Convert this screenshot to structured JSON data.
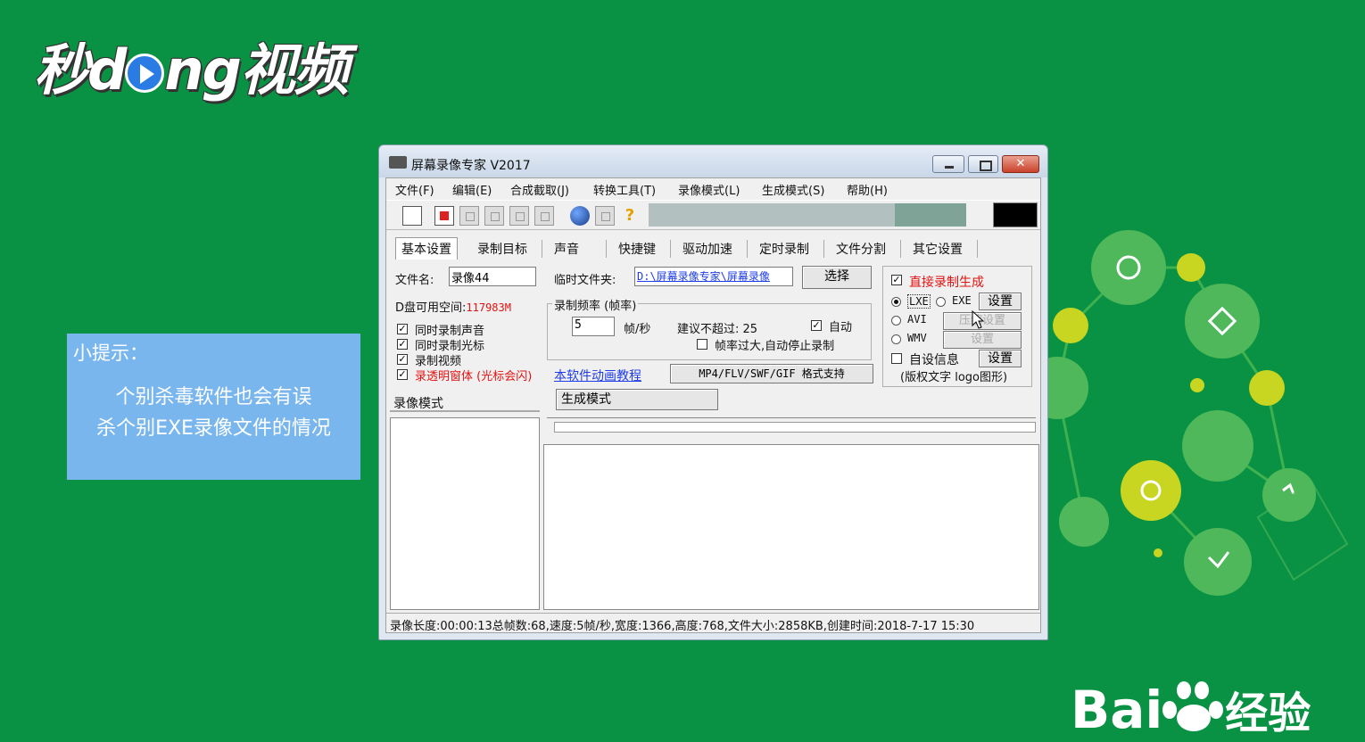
{
  "logo": {
    "part1": "秒d",
    "part2": "ng视频"
  },
  "tip": {
    "title": "小提示：",
    "line1": "个别杀毒软件也会有误",
    "line2": "杀个别EXE录像文件的情况"
  },
  "baidu": {
    "text1": "Bai",
    "text2": "经验"
  },
  "window": {
    "title": "屏幕录像专家 V2017",
    "close_glyph": "✕",
    "menu": [
      "文件(F)",
      "编辑(E)",
      "合成截取(J)",
      "转换工具(T)",
      "录像模式(L)",
      "生成模式(S)",
      "帮助(H)"
    ],
    "help_glyph": "?",
    "tabs": [
      "基本设置",
      "录制目标",
      "声音",
      "快捷键",
      "驱动加速",
      "定时录制",
      "文件分割",
      "其它设置"
    ],
    "filename_label": "文件名:",
    "filename_value": "录像44",
    "tempdir_label": "临时文件夹:",
    "tempdir_value": "D:\\屏幕录像专家\\屏幕录像",
    "choose_button": "选择",
    "disk_label": "D盘可用空间:",
    "disk_value": "117983M",
    "fps_group": "录制频率 (帧率)",
    "fps_value": "5",
    "fps_unit": "帧/秒",
    "suggest_label": "建议不超过: 25",
    "auto_label": "自动",
    "auto_checked": true,
    "stop_label": "帧率过大,自动停止录制",
    "stop_checked": false,
    "checkboxes": [
      {
        "label": "同时录制声音",
        "checked": true
      },
      {
        "label": "同时录制光标",
        "checked": true
      },
      {
        "label": "录制视频",
        "checked": true
      },
      {
        "label": "录透明窗体 (光标会闪)",
        "checked": true
      }
    ],
    "tutorial_link": "本软件动画教程",
    "format_button": "MP4/FLV/SWF/GIF  格式支持",
    "direct_label": "直接录制生成",
    "direct_checked": true,
    "radio_lxe": "LXE",
    "radio_exe": "EXE",
    "radio_avi": "AVI",
    "radio_wmv": "WMV",
    "settings_button": "设置",
    "compress_button": "压缩设置",
    "settings2_button": "设置",
    "custom_info_label": "自设信息",
    "custom_info_checked": false,
    "custom_settings_button": "设置",
    "copyright_label": "(版权文字 logo图形)",
    "left_header": "录像模式",
    "right_header": "生成模式",
    "status": "录像长度:00:00:13总帧数:68,速度:5帧/秒,宽度:1366,高度:768,文件大小:2858KB,创建时间:2018-7-17 15:30"
  },
  "colors": {
    "background": "#0a9244",
    "tip": "#79b6ee",
    "accent_red": "#e31212",
    "link": "#1f3ce8"
  }
}
